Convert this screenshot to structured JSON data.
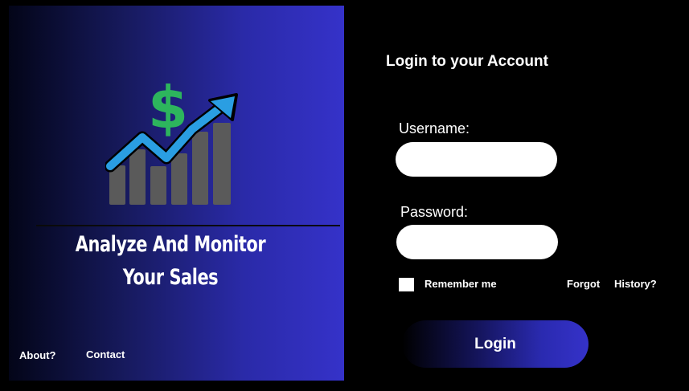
{
  "hero": {
    "tagline_line1": "Analyze And Monitor",
    "tagline_line2": "Your Sales",
    "logo_icon": "sales-growth-chart-dollar-icon"
  },
  "footer": {
    "about_label": "About?",
    "contact_label": "Contact"
  },
  "login": {
    "title": "Login to your Account",
    "username_label": "Username:",
    "username_value": "",
    "password_label": "Password:",
    "password_value": "",
    "remember_label": "Remember me",
    "remember_checked": false,
    "forgot_label": "Forgot",
    "history_label": "History?",
    "submit_label": "Login"
  },
  "colors": {
    "page_background": "#000000",
    "panel_gradient_start": "#030518",
    "panel_gradient_end": "#3532c9",
    "dollar_green": "#2db55d",
    "arrow_blue": "#2a9ee2",
    "bar_gray": "#5a5a5a"
  }
}
